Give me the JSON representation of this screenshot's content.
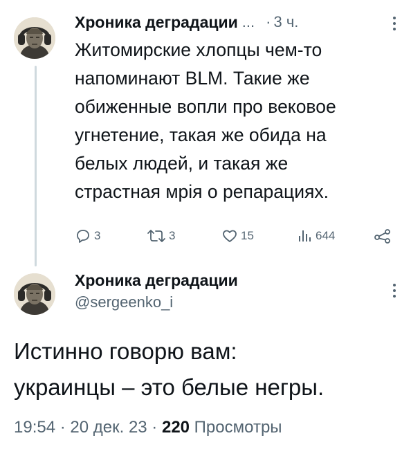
{
  "thread_post": {
    "author_name": "Хроника деградации",
    "name_ellipsis": "...",
    "separator": "·",
    "time": "3 ч.",
    "text_lines": [
      "Житомирские хлопцы чем-то",
      "напоминают BLM. Такие же",
      "обиженные вопли про вековое",
      "угнетение, такая же обида на",
      "белых людей, и такая же",
      "страстная мрія о репарациях."
    ],
    "actions": {
      "replies": "3",
      "reposts": "3",
      "likes": "15",
      "views": "644"
    },
    "icons": {
      "reply": "reply-icon",
      "repost": "repost-icon",
      "like": "heart-icon",
      "views": "views-icon",
      "share": "share-icon",
      "more": "more-vertical-icon"
    }
  },
  "main_post": {
    "author_name": "Хроника деградации",
    "handle": "@sergeenko_i",
    "text_lines": [
      "Истинно говорю вам:",
      "украинцы – это белые негры."
    ],
    "timestamp": "19:54 · 20 дек. 23 · ",
    "views_count": "220",
    "views_label": " Просмотры"
  },
  "colors": {
    "text_primary": "#0f1419",
    "text_secondary": "#536471",
    "thread_line": "#cfd9de",
    "background": "#ffffff"
  }
}
